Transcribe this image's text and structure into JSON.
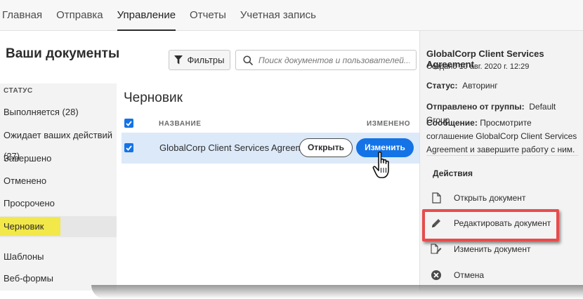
{
  "nav": {
    "tabs": [
      {
        "label": "Главная"
      },
      {
        "label": "Отправка"
      },
      {
        "label": "Управление",
        "active": true
      },
      {
        "label": "Отчеты"
      },
      {
        "label": "Учетная запись"
      }
    ]
  },
  "page": {
    "title": "Ваши документы",
    "filter_label": "Фильтры",
    "search_placeholder": "Поиск документов и пользователей..."
  },
  "sidebar": {
    "heading": "СТАТУС",
    "items": [
      {
        "label": "Выполняется (28)"
      },
      {
        "label": "Ожидает ваших действий (27)"
      },
      {
        "label": "Завершено"
      },
      {
        "label": "Отменено"
      },
      {
        "label": "Просрочено"
      },
      {
        "label": "Черновик",
        "selected": true
      },
      {
        "label": "Шаблоны"
      },
      {
        "label": "Веб-формы"
      }
    ]
  },
  "content": {
    "title": "Черновик",
    "columns": {
      "name": "НАЗВАНИЕ",
      "modified": "ИЗМЕНЕНО"
    },
    "rows": [
      {
        "name": "GlobalCorp Client Services Agreement",
        "open_label": "Открыть",
        "edit_label": "Изменить"
      }
    ]
  },
  "details": {
    "doc_title": "GlobalCorp Client Services Agreement",
    "created": "Создано 10 авг. 2020 г. 12:29",
    "status_label": "Статус:",
    "status_value": "Авторинг",
    "group_label": "Отправлено от группы:",
    "group_value": "Default Group",
    "message_label": "Сообщение:",
    "message_value": "Просмотрите соглашение GlobalCorp Client Services Agreement и завершите работу с ним.",
    "actions_heading": "Действия",
    "actions": [
      {
        "label": "Открыть документ",
        "icon": "document-icon"
      },
      {
        "label": "Редактировать документ",
        "icon": "pencil-icon"
      },
      {
        "label": "Изменить документ",
        "icon": "modify-document-icon"
      },
      {
        "label": "Отмена",
        "icon": "cancel-circle-icon"
      }
    ]
  },
  "colors": {
    "accent": "#1473e6",
    "selected_row": "#dce9f9",
    "highlight_yellow": "#f2e84a",
    "callout_red": "#e74c4c"
  }
}
